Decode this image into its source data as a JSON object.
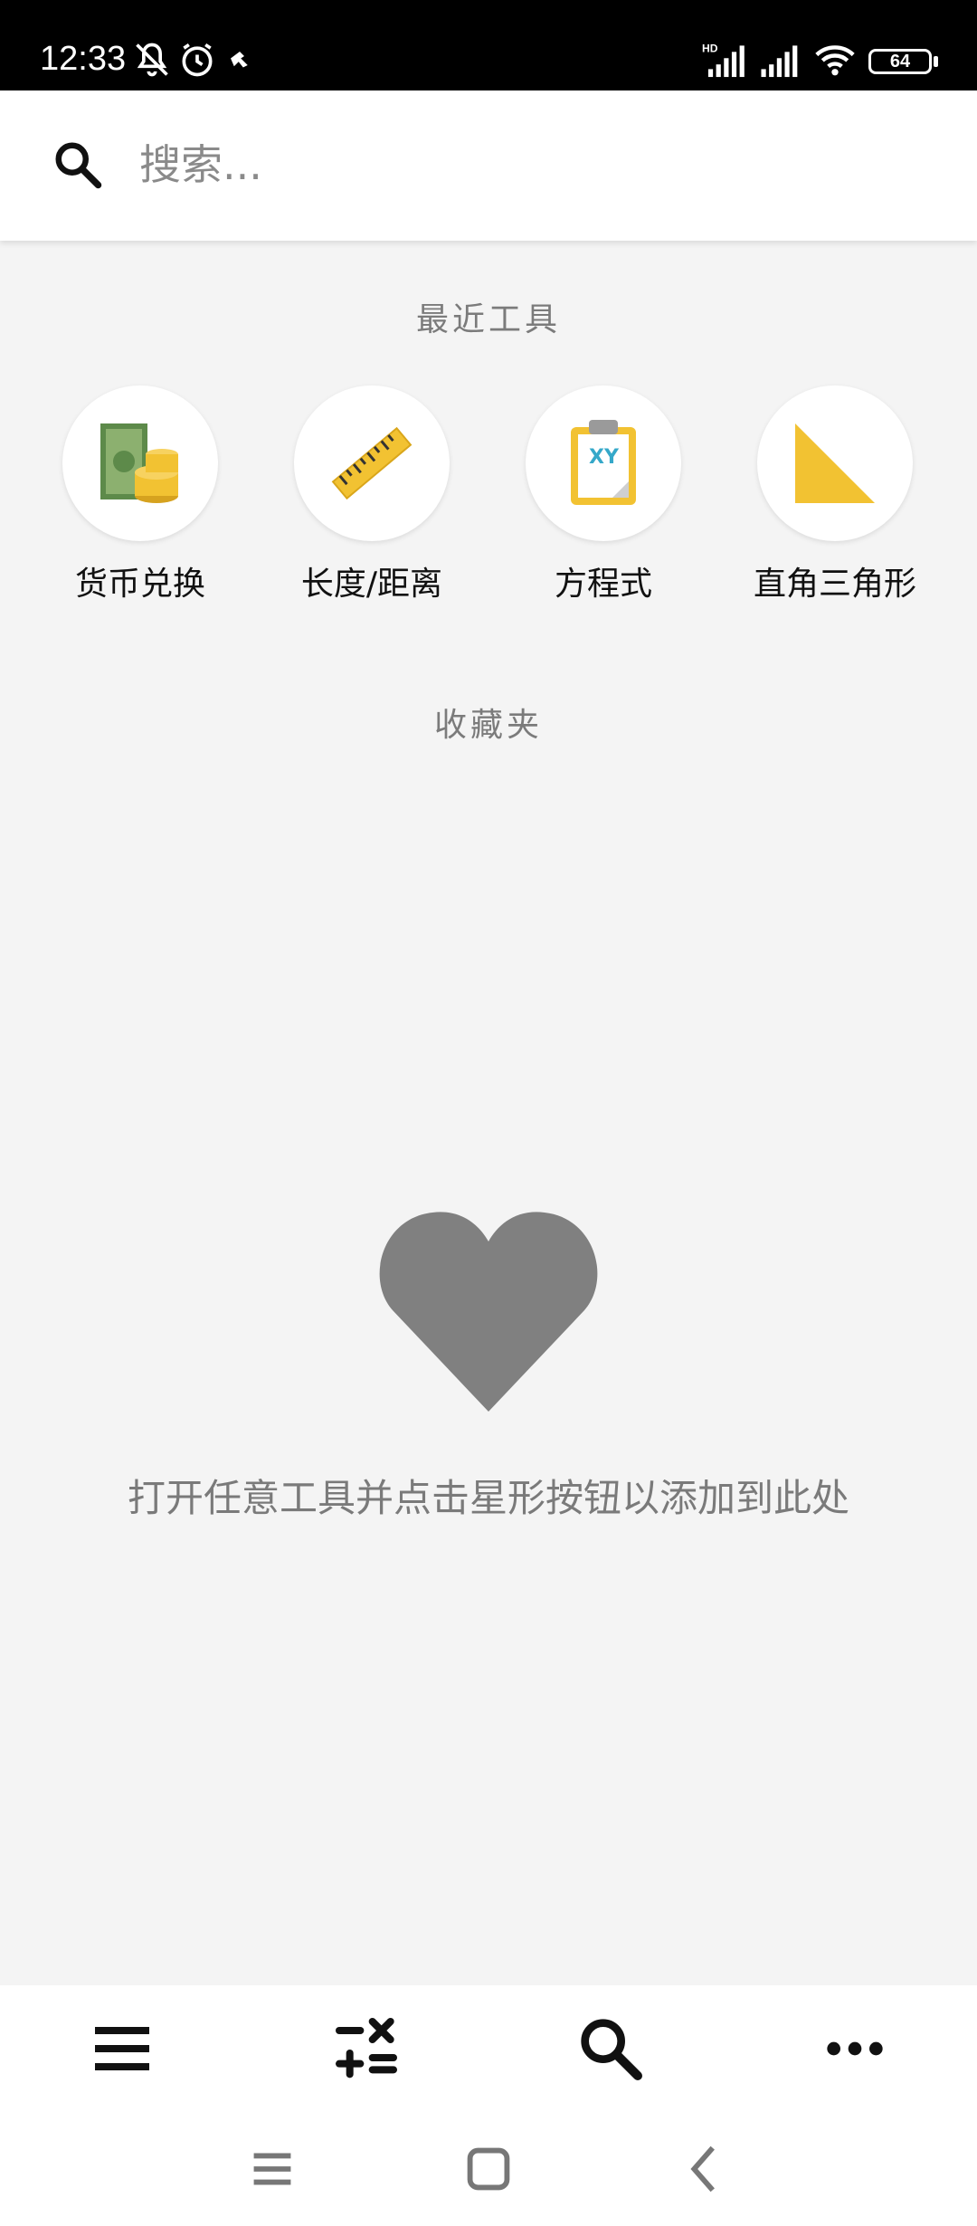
{
  "status_bar": {
    "time": "12:33",
    "battery": "64"
  },
  "search": {
    "placeholder": "搜索..."
  },
  "recent": {
    "title": "最近工具",
    "tools": [
      {
        "label": "货币兑换",
        "icon": "currency-exchange-icon"
      },
      {
        "label": "长度/距离",
        "icon": "ruler-icon"
      },
      {
        "label": "方程式",
        "icon": "equation-clipboard-icon"
      },
      {
        "label": "直角三角形",
        "icon": "right-triangle-icon"
      }
    ]
  },
  "favorites": {
    "title": "收藏夹",
    "empty_message": "打开任意工具并点击星形按钮以添加到此处"
  },
  "bottom_nav": [
    "menu-icon",
    "calculator-icon",
    "search-icon",
    "more-icon"
  ],
  "colors": {
    "background": "#f4f4f4",
    "heart": "#808080",
    "accent_yellow": "#f2c232"
  }
}
